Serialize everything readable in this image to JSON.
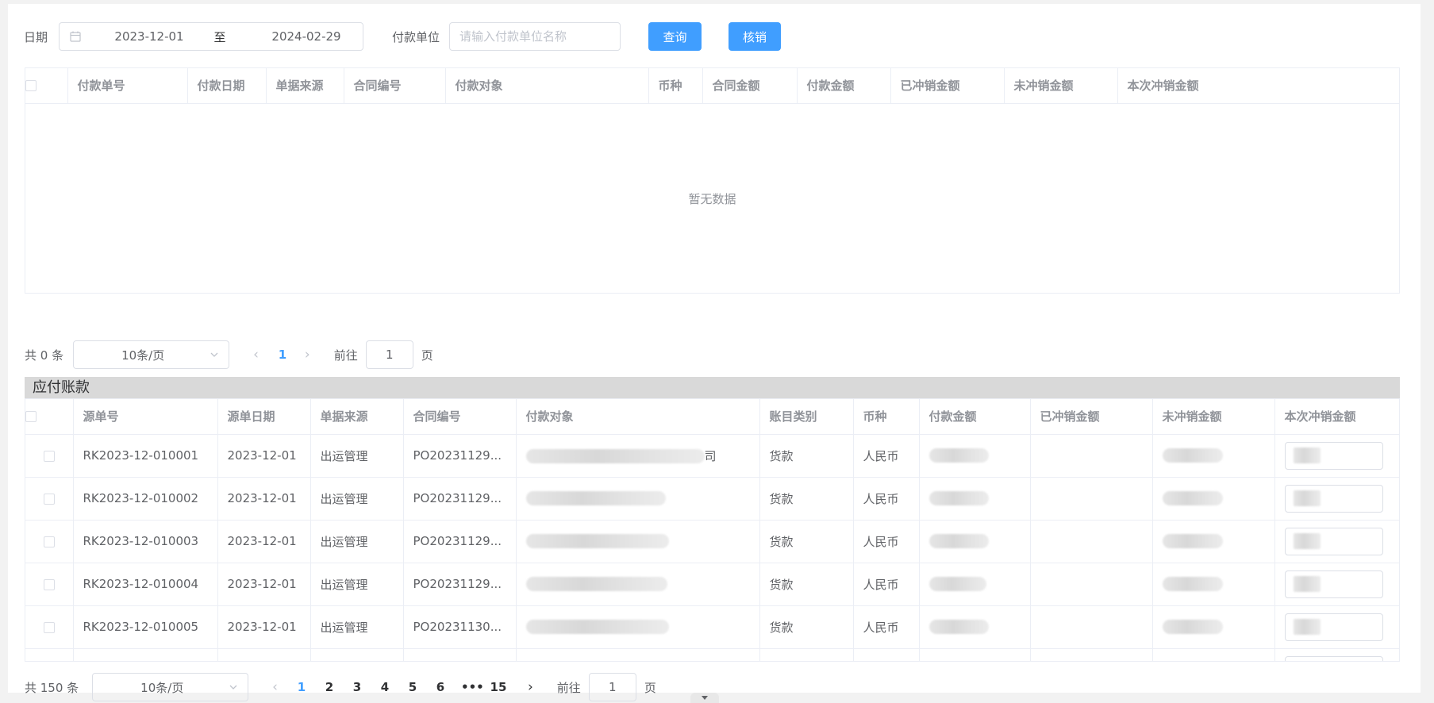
{
  "filter": {
    "date_label": "日期",
    "date_start": "2023-12-01",
    "date_separator": "至",
    "date_end": "2024-02-29",
    "payer_label": "付款单位",
    "payer_placeholder": "请输入付款单位名称",
    "query_button": "查询",
    "writeoff_button": "核销"
  },
  "payment_table": {
    "columns": [
      "付款单号",
      "付款日期",
      "单据来源",
      "合同编号",
      "付款对象",
      "币种",
      "合同金额",
      "付款金额",
      "已冲销金额",
      "未冲销金额",
      "本次冲销金额"
    ],
    "empty_text": "暂无数据"
  },
  "pager1": {
    "total": "共 0 条",
    "page_size": "10条/页",
    "pages": [
      "1"
    ],
    "current": "1",
    "goto_label": "前往",
    "goto_value": "1",
    "page_suffix": "页"
  },
  "payables": {
    "title": "应付账款",
    "columns": [
      "源单号",
      "源单日期",
      "单据来源",
      "合同编号",
      "付款对象",
      "账目类别",
      "币种",
      "付款金额",
      "已冲销金额",
      "未冲销金额",
      "本次冲销金额"
    ],
    "rows": [
      {
        "id": "RK2023-12-010001",
        "date": "2023-12-01",
        "source": "出运管理",
        "contract": "PO20231129...",
        "payee_suffix": "司",
        "category": "货款",
        "currency": "人民币"
      },
      {
        "id": "RK2023-12-010002",
        "date": "2023-12-01",
        "source": "出运管理",
        "contract": "PO20231129...",
        "payee_suffix": "",
        "category": "货款",
        "currency": "人民币"
      },
      {
        "id": "RK2023-12-010003",
        "date": "2023-12-01",
        "source": "出运管理",
        "contract": "PO20231129...",
        "payee_suffix": "",
        "category": "货款",
        "currency": "人民币"
      },
      {
        "id": "RK2023-12-010004",
        "date": "2023-12-01",
        "source": "出运管理",
        "contract": "PO20231129...",
        "payee_suffix": "",
        "category": "货款",
        "currency": "人民币"
      },
      {
        "id": "RK2023-12-010005",
        "date": "2023-12-01",
        "source": "出运管理",
        "contract": "PO20231130...",
        "payee_suffix": "",
        "category": "货款",
        "currency": "人民币"
      }
    ]
  },
  "pager2": {
    "total": "共 150 条",
    "page_size": "10条/页",
    "pages": [
      "1",
      "2",
      "3",
      "4",
      "5",
      "6",
      "•••",
      "15"
    ],
    "current": "1",
    "goto_label": "前往",
    "goto_value": "1",
    "page_suffix": "页"
  },
  "colors": {
    "primary": "#409eff",
    "section_bg": "#d9d9d9",
    "border": "#ebeef5"
  },
  "icons": [
    "calendar-icon",
    "chevron-down-icon",
    "chevron-left-icon",
    "chevron-right-icon"
  ]
}
